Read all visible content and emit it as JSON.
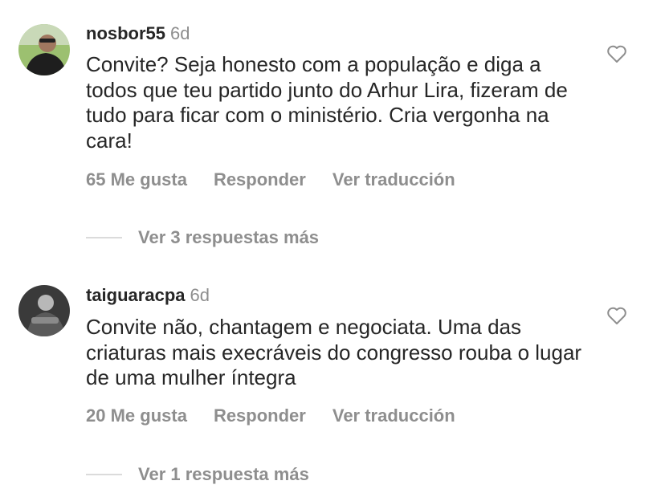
{
  "comments": [
    {
      "username": "nosbor55",
      "time": "6d",
      "text": "Convite? Seja honesto com a população e diga a todos que teu partido junto do Arhur Lira, fizeram de tudo para ficar com o ministério. Cria vergonha na cara!",
      "likes_label": "65 Me gusta",
      "reply_label": "Responder",
      "translate_label": "Ver traducción",
      "view_replies_label": "Ver 3 respuestas más"
    },
    {
      "username": "taiguaracpa",
      "time": "6d",
      "text": "Convite não, chantagem e negociata. Uma das criaturas mais execráveis do congresso rouba o lugar de uma mulher íntegra",
      "likes_label": "20 Me gusta",
      "reply_label": "Responder",
      "translate_label": "Ver traducción",
      "view_replies_label": "Ver 1 respuesta más"
    }
  ],
  "icons": {
    "like": "heart-outline-icon"
  },
  "colors": {
    "text": "#262626",
    "secondary": "#8e8e8e",
    "divider": "#dbdbdb"
  }
}
